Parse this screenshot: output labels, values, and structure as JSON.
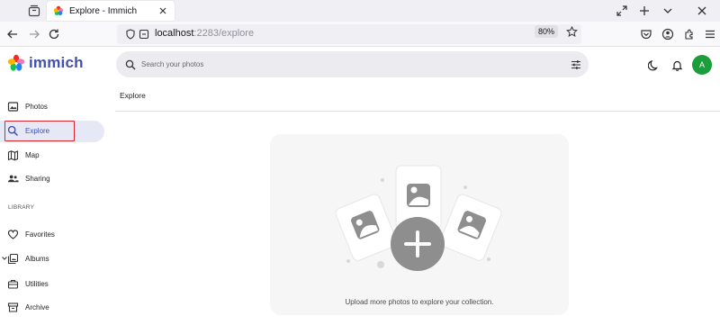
{
  "browser": {
    "tab_title": "Explore - Immich",
    "url_host": "localhost",
    "url_path": ":2283/explore",
    "zoom": "80%"
  },
  "app": {
    "logo_text": "immich",
    "search_placeholder": "Search your photos",
    "avatar_initial": "A",
    "avatar_color": "#1a9e3b",
    "accent": "#4250af"
  },
  "sidebar": {
    "items": [
      {
        "label": "Photos",
        "icon": "photos-icon"
      },
      {
        "label": "Explore",
        "icon": "search-icon"
      },
      {
        "label": "Map",
        "icon": "map-icon"
      },
      {
        "label": "Sharing",
        "icon": "people-icon"
      }
    ],
    "library_heading": "LIBRARY",
    "library_items": [
      {
        "label": "Favorites",
        "icon": "heart-icon"
      },
      {
        "label": "Albums",
        "icon": "album-icon"
      },
      {
        "label": "Utilities",
        "icon": "toolbox-icon"
      },
      {
        "label": "Archive",
        "icon": "archive-icon"
      }
    ]
  },
  "main": {
    "title": "Explore",
    "empty_message": "Upload more photos to explore your collection."
  }
}
